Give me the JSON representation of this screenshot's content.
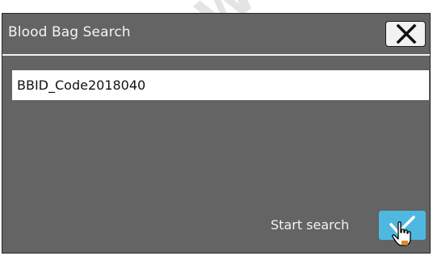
{
  "dialog": {
    "title": "Blood Bag Search",
    "close_icon": "close-x-icon"
  },
  "search": {
    "value": "BBID_Code2018040"
  },
  "footer": {
    "start_label": "Start search",
    "confirm_icon": "checkmark-icon"
  },
  "colors": {
    "dialog_bg": "#646464",
    "confirm_button": "#4fb8e0",
    "title_text": "#f4f4f4"
  }
}
